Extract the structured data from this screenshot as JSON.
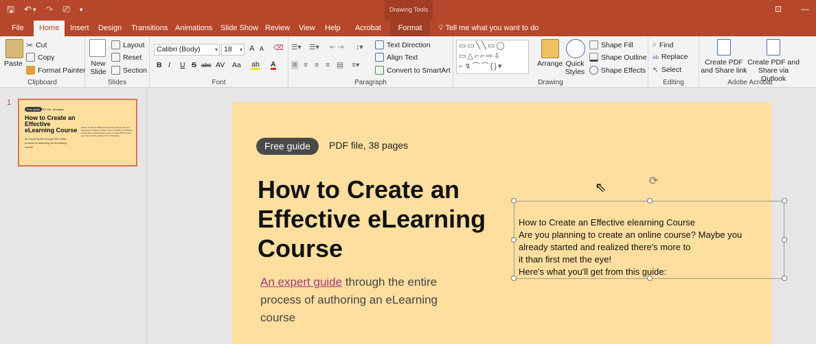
{
  "qat": {
    "save": "🖫",
    "undo": "↶",
    "undo_dd": "▾",
    "redo": "↷",
    "present": "⎚",
    "customize": "▾"
  },
  "window": {
    "context_title": "Drawing Tools",
    "ribbon_display": "⊡",
    "minimize": "—"
  },
  "tabs": [
    "File",
    "Home",
    "Insert",
    "Design",
    "Transitions",
    "Animations",
    "Slide Show",
    "Review",
    "View",
    "Help",
    "Acrobat",
    "Format"
  ],
  "tell_me": "Tell me what you want to do",
  "ribbon": {
    "clipboard": {
      "paste": "Paste",
      "cut": "Cut",
      "copy": "Copy",
      "format_painter": "Format Painter",
      "label": "Clipboard"
    },
    "slides": {
      "new_slide": "New Slide",
      "layout": "Layout",
      "reset": "Reset",
      "section": "Section",
      "label": "Slides"
    },
    "font": {
      "name": "Calibri (Body)",
      "size": "18",
      "grow": "A",
      "shrink": "A",
      "bold": "B",
      "italic": "I",
      "underline": "U",
      "strike": "S",
      "shadow": "abc",
      "spacing": "AV",
      "case": "Aa",
      "highlight": "ab",
      "color": "A",
      "label": "Font"
    },
    "paragraph": {
      "text_direction": "Text Direction",
      "align_text": "Align Text",
      "convert_smartart": "Convert to SmartArt",
      "label": "Paragraph"
    },
    "drawing": {
      "arrange": "Arrange",
      "quick_styles": "Quick Styles",
      "shape_fill": "Shape Fill",
      "shape_outline": "Shape Outline",
      "shape_effects": "Shape Effects",
      "label": "Drawing"
    },
    "editing": {
      "find": "Find",
      "replace": "Replace",
      "select": "Select",
      "label": "Editing"
    },
    "acrobat": {
      "create_share_link": "Create PDF and Share link",
      "create_share_outlook": "Create PDF and Share via Outlook",
      "label": "Adobe Acrobat"
    }
  },
  "thumbnail": {
    "number": "1",
    "badge": "Free guide",
    "badge_text": "PDF file, 38 pages",
    "title": "How to Create an Effective eLearning Course",
    "subtitle": "An expert guide through the entire process of authoring an eLearning course",
    "body": "How to Create an Effective elearning Course Are you planning to create an online course? Maybe you already started and realized there's more to it than first met the eye! Here's what you'll get from this guide:"
  },
  "slide": {
    "badge": "Free guide",
    "badge_text": "PDF file, 38 pages",
    "title": "How to Create an Effective eLearning Course",
    "subtitle_link": "An expert guide",
    "subtitle_rest": " through the entire process of authoring an eLearning course",
    "textbox_lines": [
      "How to Create an Effective elearning Course",
      "Are you planning to create an online course? Maybe you",
      "already started and realized there's more to",
      "it than first met the eye!",
      "Here's what you'll get from this guide:"
    ]
  }
}
